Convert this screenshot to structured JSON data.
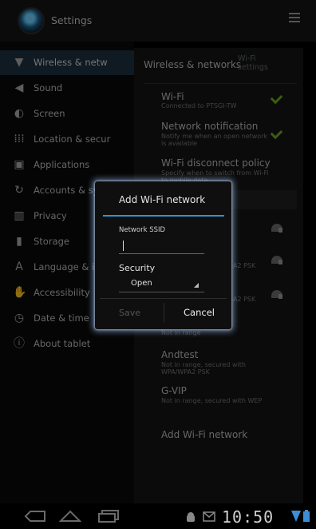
{
  "app": {
    "title": "Settings"
  },
  "sidebar": {
    "items": [
      {
        "label": "Wireless & netw",
        "icon": "wifi-icon",
        "active": true
      },
      {
        "label": "Sound",
        "icon": "speaker-icon"
      },
      {
        "label": "Screen",
        "icon": "screen-icon"
      },
      {
        "label": "Location & secur",
        "icon": "grid-icon"
      },
      {
        "label": "Applications",
        "icon": "applications-icon"
      },
      {
        "label": "Accounts & syn",
        "icon": "sync-icon"
      },
      {
        "label": "Privacy",
        "icon": "privacy-icon"
      },
      {
        "label": "Storage",
        "icon": "storage-icon"
      },
      {
        "label": "Language & in",
        "icon": "language-icon"
      },
      {
        "label": "Accessibility",
        "icon": "hand-icon"
      },
      {
        "label": "Date & time",
        "icon": "clock-icon"
      },
      {
        "label": "About tablet",
        "icon": "info-icon"
      }
    ]
  },
  "panel": {
    "title": "Wireless & networks",
    "tab": "Wi-Fi settings",
    "wifi": {
      "title": "Wi-Fi",
      "sub": "Connected to PTSGI-TW"
    },
    "notify": {
      "title": "Network notification",
      "sub": "Notify me when an open network is available"
    },
    "policy": {
      "title": "Wi-Fi disconnect policy",
      "sub": "Specify when to switch from Wi-Fi to mobile data"
    },
    "net1_sub": "A2 PSK",
    "net2_sub": "A2 PSK",
    "net3_sub": "Not in range",
    "andtest": {
      "title": "Andtest",
      "sub": "Not in range, secured with WPA/WPA2 PSK"
    },
    "gvip": {
      "title": "G-VIP",
      "sub": "Not in range, secured with WEP"
    },
    "add_network": "Add Wi-Fi network"
  },
  "dialog": {
    "title": "Add Wi-Fi network",
    "ssid_label": "Network SSID",
    "ssid_value": "",
    "security_label": "Security",
    "security_value": "Open",
    "save_label": "Save",
    "cancel_label": "Cancel"
  },
  "status": {
    "time": "10:50"
  },
  "colors": {
    "accent": "#2d94d4",
    "check": "#6ea821"
  }
}
